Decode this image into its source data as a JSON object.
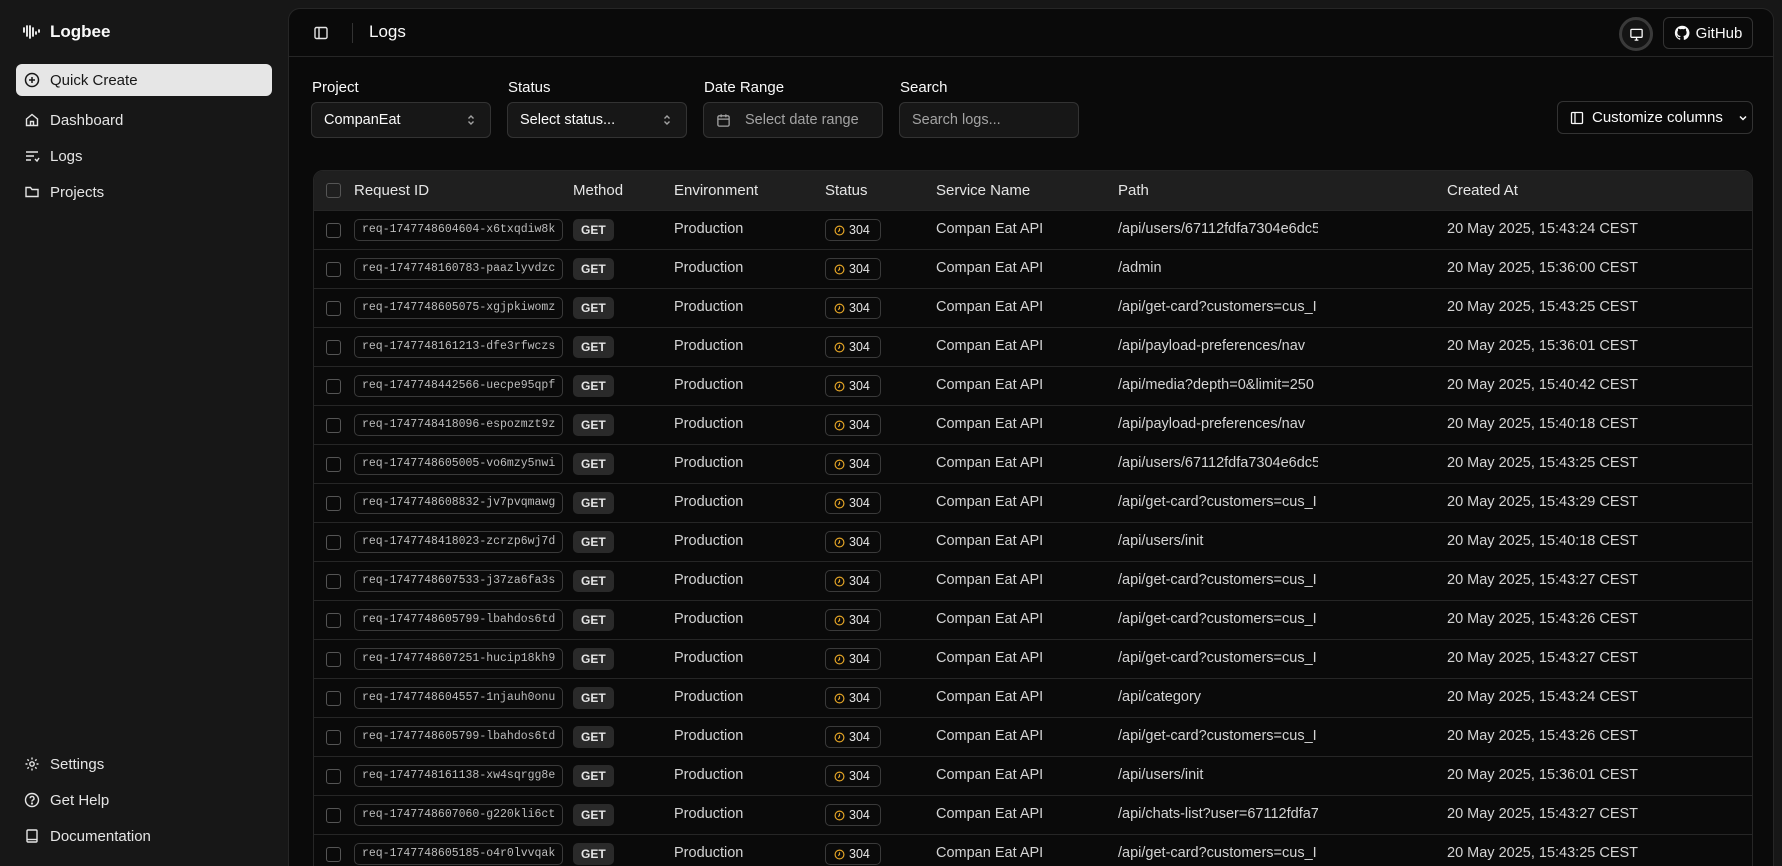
{
  "brand": {
    "name": "Logbee",
    "icon": "waveform-logo-icon"
  },
  "sidebar": {
    "quick_create": "Quick Create",
    "items": [
      {
        "label": "Dashboard",
        "icon": "home-icon"
      },
      {
        "label": "Logs",
        "icon": "list-icon"
      },
      {
        "label": "Projects",
        "icon": "folder-icon"
      }
    ],
    "bottom_items": [
      {
        "label": "Settings",
        "icon": "gear-icon"
      },
      {
        "label": "Get Help",
        "icon": "help-circle-icon"
      },
      {
        "label": "Documentation",
        "icon": "book-icon"
      }
    ]
  },
  "header": {
    "title": "Logs",
    "github_label": "GitHub"
  },
  "filters": {
    "project_label": "Project",
    "project_value": "CompanEat",
    "status_label": "Status",
    "status_placeholder": "Select status...",
    "date_label": "Date Range",
    "date_placeholder": "Select date range",
    "search_label": "Search",
    "search_placeholder": "Search logs...",
    "customize_label": "Customize columns"
  },
  "table": {
    "columns": [
      "Request ID",
      "Method",
      "Environment",
      "Status",
      "Service Name",
      "Path",
      "Created At"
    ],
    "rows": [
      {
        "id": "req-1747748604604-x6txqdiw8k",
        "method": "GET",
        "env": "Production",
        "status": "304",
        "service": "Compan Eat API",
        "path": "/api/users/67112fdfa7304e6dc5",
        "created": "20 May 2025, 15:43:24 CEST"
      },
      {
        "id": "req-1747748160783-paazlyvdzc",
        "method": "GET",
        "env": "Production",
        "status": "304",
        "service": "Compan Eat API",
        "path": "/admin",
        "created": "20 May 2025, 15:36:00 CEST"
      },
      {
        "id": "req-1747748605075-xgjpkiwomz",
        "method": "GET",
        "env": "Production",
        "status": "304",
        "service": "Compan Eat API",
        "path": "/api/get-card?customers=cus_I",
        "created": "20 May 2025, 15:43:25 CEST"
      },
      {
        "id": "req-1747748161213-dfe3rfwczs",
        "method": "GET",
        "env": "Production",
        "status": "304",
        "service": "Compan Eat API",
        "path": "/api/payload-preferences/nav",
        "created": "20 May 2025, 15:36:01 CEST"
      },
      {
        "id": "req-1747748442566-uecpe95qpf",
        "method": "GET",
        "env": "Production",
        "status": "304",
        "service": "Compan Eat API",
        "path": "/api/media?depth=0&limit=250",
        "created": "20 May 2025, 15:40:42 CEST"
      },
      {
        "id": "req-1747748418096-espozmzt9z",
        "method": "GET",
        "env": "Production",
        "status": "304",
        "service": "Compan Eat API",
        "path": "/api/payload-preferences/nav",
        "created": "20 May 2025, 15:40:18 CEST"
      },
      {
        "id": "req-1747748605005-vo6mzy5nwi",
        "method": "GET",
        "env": "Production",
        "status": "304",
        "service": "Compan Eat API",
        "path": "/api/users/67112fdfa7304e6dc5",
        "created": "20 May 2025, 15:43:25 CEST"
      },
      {
        "id": "req-1747748608832-jv7pvqmawg",
        "method": "GET",
        "env": "Production",
        "status": "304",
        "service": "Compan Eat API",
        "path": "/api/get-card?customers=cus_I",
        "created": "20 May 2025, 15:43:29 CEST"
      },
      {
        "id": "req-1747748418023-zcrzp6wj7d",
        "method": "GET",
        "env": "Production",
        "status": "304",
        "service": "Compan Eat API",
        "path": "/api/users/init",
        "created": "20 May 2025, 15:40:18 CEST"
      },
      {
        "id": "req-1747748607533-j37za6fa3s",
        "method": "GET",
        "env": "Production",
        "status": "304",
        "service": "Compan Eat API",
        "path": "/api/get-card?customers=cus_I",
        "created": "20 May 2025, 15:43:27 CEST"
      },
      {
        "id": "req-1747748605799-lbahdos6td",
        "method": "GET",
        "env": "Production",
        "status": "304",
        "service": "Compan Eat API",
        "path": "/api/get-card?customers=cus_I",
        "created": "20 May 2025, 15:43:26 CEST"
      },
      {
        "id": "req-1747748607251-hucip18kh9",
        "method": "GET",
        "env": "Production",
        "status": "304",
        "service": "Compan Eat API",
        "path": "/api/get-card?customers=cus_I",
        "created": "20 May 2025, 15:43:27 CEST"
      },
      {
        "id": "req-1747748604557-1njauh0onu",
        "method": "GET",
        "env": "Production",
        "status": "304",
        "service": "Compan Eat API",
        "path": "/api/category",
        "created": "20 May 2025, 15:43:24 CEST"
      },
      {
        "id": "req-1747748605799-lbahdos6td",
        "method": "GET",
        "env": "Production",
        "status": "304",
        "service": "Compan Eat API",
        "path": "/api/get-card?customers=cus_I",
        "created": "20 May 2025, 15:43:26 CEST"
      },
      {
        "id": "req-1747748161138-xw4sqrgg8e",
        "method": "GET",
        "env": "Production",
        "status": "304",
        "service": "Compan Eat API",
        "path": "/api/users/init",
        "created": "20 May 2025, 15:36:01 CEST"
      },
      {
        "id": "req-1747748607060-g220kli6ct",
        "method": "GET",
        "env": "Production",
        "status": "304",
        "service": "Compan Eat API",
        "path": "/api/chats-list?user=67112fdfa7",
        "created": "20 May 2025, 15:43:27 CEST"
      },
      {
        "id": "req-1747748605185-o4r0lvvqak",
        "method": "GET",
        "env": "Production",
        "status": "304",
        "service": "Compan Eat API",
        "path": "/api/get-card?customers=cus_I",
        "created": "20 May 2025, 15:43:25 CEST"
      }
    ]
  },
  "colors": {
    "status_304": "#e5a526",
    "accent_button": "#e6e6e6"
  }
}
